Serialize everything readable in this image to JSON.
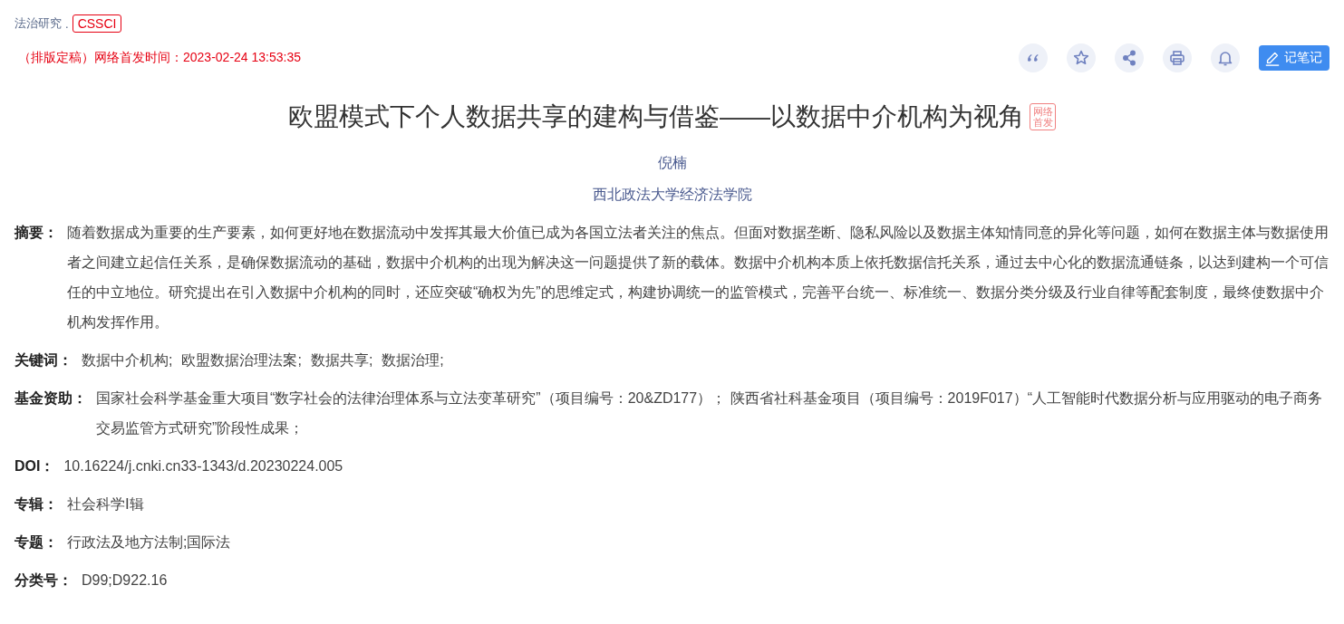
{
  "journal": {
    "name": "法治研究",
    "separator": ".",
    "badge": "CSSCI"
  },
  "publish_info": "（排版定稿）网络首发时间：2023-02-24 13:53:35",
  "toolbar": [
    {
      "kind": "quote"
    },
    {
      "kind": "star"
    },
    {
      "kind": "share"
    },
    {
      "kind": "print"
    },
    {
      "kind": "bell"
    },
    {
      "kind": "note",
      "label": "记笔记"
    }
  ],
  "title": "欧盟模式下个人数据共享的建构与借鉴——以数据中介机构为视角",
  "title_badge": [
    "网络",
    "首发"
  ],
  "author": "倪楠",
  "affiliation": "西北政法大学经济法学院",
  "fields": [
    {
      "kind": "text",
      "label": "摘要：",
      "value": "随着数据成为重要的生产要素，如何更好地在数据流动中发挥其最大价值已成为各国立法者关注的焦点。但面对数据垄断、隐私风险以及数据主体知情同意的异化等问题，如何在数据主体与数据使用者之间建立起信任关系，是确保数据流动的基础，数据中介机构的出现为解决这一问题提供了新的载体。数据中介机构本质上依托数据信托关系，通过去中心化的数据流通链条，以达到建构一个可信任的中立地位。研究提出在引入数据中介机构的同时，还应突破“确权为先”的思维定式，构建协调统一的监管模式，完善平台统一、标准统一、数据分类分级及行业自律等配套制度，最终使数据中介机构发挥作用。"
    },
    {
      "kind": "links",
      "label": "关键词：",
      "items": [
        "数据中介机构;",
        "欧盟数据治理法案;",
        "数据共享;",
        "数据治理;"
      ]
    },
    {
      "kind": "text",
      "label": "基金资助：",
      "value": "国家社会科学基金重大项目“数字社会的法律治理体系与立法变革研究”（项目编号：20&ZD177）； 陕西省社科基金项目（项目编号：2019F017）“人工智能时代数据分析与应用驱动的电子商务交易监管方式研究”阶段性成果；"
    },
    {
      "kind": "text",
      "label": "DOI：",
      "value": "10.16224/j.cnki.cn33-1343/d.20230224.005"
    },
    {
      "kind": "text",
      "label": "专辑：",
      "value": "社会科学Ⅰ辑"
    },
    {
      "kind": "text",
      "label": "专题：",
      "value": "行政法及地方法制;国际法"
    },
    {
      "kind": "text",
      "label": "分类号：",
      "value": "D99;D922.16"
    }
  ]
}
